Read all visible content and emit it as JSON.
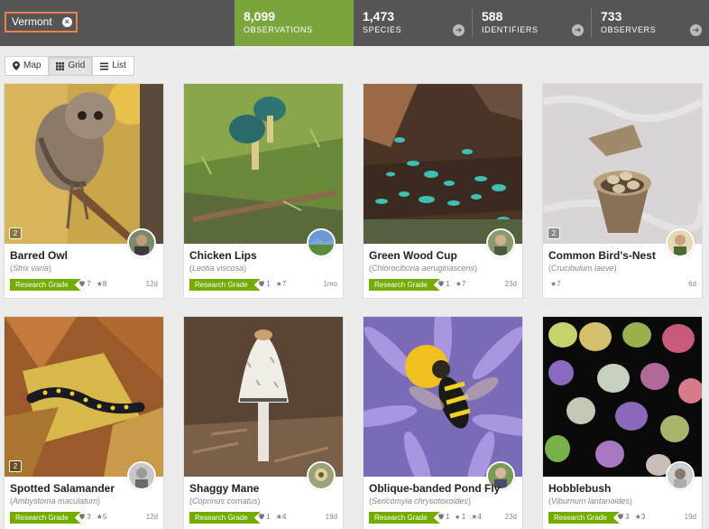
{
  "place": {
    "label": "Vermont"
  },
  "stats": [
    {
      "num": "8,099",
      "label": "OBSERVATIONS"
    },
    {
      "num": "1,473",
      "label": "SPECIES"
    },
    {
      "num": "588",
      "label": "IDENTIFIERS"
    },
    {
      "num": "733",
      "label": "OBSERVERS"
    }
  ],
  "views": {
    "map": "Map",
    "grid": "Grid",
    "list": "List"
  },
  "grade_label": "Research Grade",
  "cards": [
    {
      "name": "Barred Owl",
      "sci": "Strix varia",
      "count": "2",
      "ids": "7",
      "faves": "8",
      "comments": "",
      "age": "12d",
      "graded": true
    },
    {
      "name": "Chicken Lips",
      "sci": "Leotia viscosa",
      "count": "",
      "ids": "1",
      "faves": "7",
      "comments": "",
      "age": "1mo",
      "graded": true
    },
    {
      "name": "Green Wood Cup",
      "sci": "Chlorociboria aeruginascens",
      "count": "",
      "ids": "1",
      "faves": "7",
      "comments": "",
      "age": "23d",
      "graded": true
    },
    {
      "name": "Common Bird's-Nest",
      "sci": "Crucibulum laeve",
      "count": "2",
      "ids": "",
      "faves": "7",
      "comments": "",
      "age": "6d",
      "graded": false
    },
    {
      "name": "Spotted Salamander",
      "sci": "Ambystoma maculatum",
      "count": "2",
      "ids": "3",
      "faves": "5",
      "comments": "",
      "age": "12d",
      "graded": true
    },
    {
      "name": "Shaggy Mane",
      "sci": "Coprinus comatus",
      "count": "",
      "ids": "1",
      "faves": "4",
      "comments": "",
      "age": "19d",
      "graded": true
    },
    {
      "name": "Oblique-banded Pond Fly",
      "sci": "Sericomyia chrysotoxoides",
      "count": "",
      "ids": "1",
      "faves": "4",
      "comments": "1",
      "age": "23d",
      "graded": true
    },
    {
      "name": "Hobblebush",
      "sci": "Viburnum lantanoides",
      "count": "",
      "ids": "3",
      "faves": "3",
      "comments": "",
      "age": "19d",
      "graded": true
    }
  ],
  "colors": {
    "bar": "#555555",
    "active_stat": "#7ba43c",
    "grade": "#74ac00",
    "place_border": "#e8824a"
  }
}
